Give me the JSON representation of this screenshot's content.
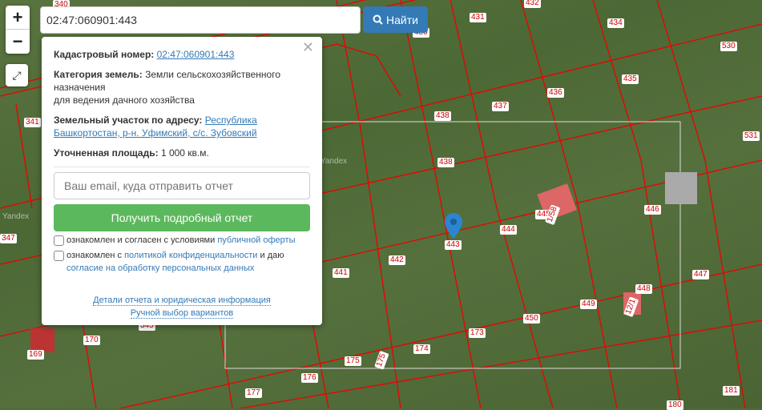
{
  "search": {
    "value": "02:47:060901:443",
    "button": "Найти"
  },
  "map_controls": {
    "zoom_in": "+",
    "zoom_out": "−"
  },
  "watermarks": [
    "Yandex",
    "Yandex"
  ],
  "parcels": [
    "340",
    "431",
    "432",
    "430",
    "434",
    "530",
    "435",
    "436",
    "437",
    "438",
    "341",
    "531",
    "438",
    "446",
    "445",
    "444",
    "443",
    "442",
    "441",
    "347",
    "447",
    "448",
    "449",
    "450",
    "173",
    "174",
    "175",
    "176",
    "177",
    "170",
    "169",
    "345",
    "180",
    "181",
    "175",
    "1/58",
    "12/1"
  ],
  "popup": {
    "cadastral_label": "Кадастровый номер:",
    "cadastral_value": "02:47:060901:443",
    "category_label": "Категория земель:",
    "category_value": "Земли сельскохозяйственного назначения",
    "category_use": "для ведения дачного хозяйства",
    "address_label": "Земельный участок по адресу:",
    "address_value": "Республика Башкортостан, р-н. Уфимский, с/с. Зубовский",
    "area_label": "Уточненная площадь:",
    "area_value": "1 000 кв.м.",
    "email_placeholder": "Ваш email, куда отправить отчет",
    "report_button": "Получить подробный отчет",
    "agree1_text": "ознакомлен и согласен с условиями ",
    "agree1_link": "публичной оферты",
    "agree2_text": "ознакомлен с ",
    "agree2_link": "политикой конфиденциальности",
    "agree2_mid": " и даю",
    "agree2_link2": "согласие на обработку персональных данных",
    "details_link": "Детали отчета и юридическая информация",
    "manual_link": "Ручной выбор вариантов"
  }
}
